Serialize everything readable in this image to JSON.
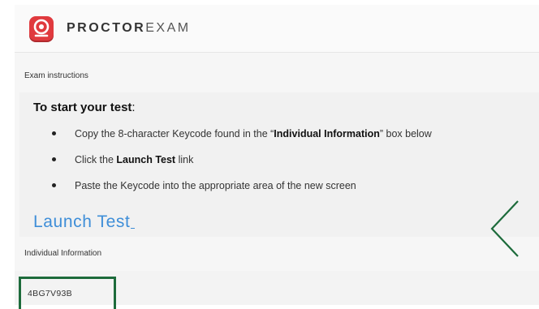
{
  "header": {
    "brand_bold": "PROCTOR",
    "brand_light": "EXAM"
  },
  "exam_section": {
    "label": "Exam instructions",
    "title_main": "To start your test",
    "title_colon": ":",
    "bullets": [
      {
        "before": "Copy the 8-character Keycode found in the “",
        "bold": "Individual Information",
        "after": "” box below"
      },
      {
        "before": "Click the ",
        "bold": "Launch Test",
        "after": " link"
      },
      {
        "before": "Paste the Keycode into the appropriate area of the new screen",
        "bold": "",
        "after": ""
      }
    ],
    "launch_link": "Launch Test"
  },
  "individual_section": {
    "label": "Individual Information",
    "keycode": "4BG7V93B"
  },
  "colors": {
    "brand_red": "#e03a3e",
    "link_blue": "#3e8ed8",
    "highlight_green": "#1d6b3b"
  },
  "icons": {
    "logo": "proctor-webcam-icon",
    "nav": "chevron-left-icon"
  }
}
